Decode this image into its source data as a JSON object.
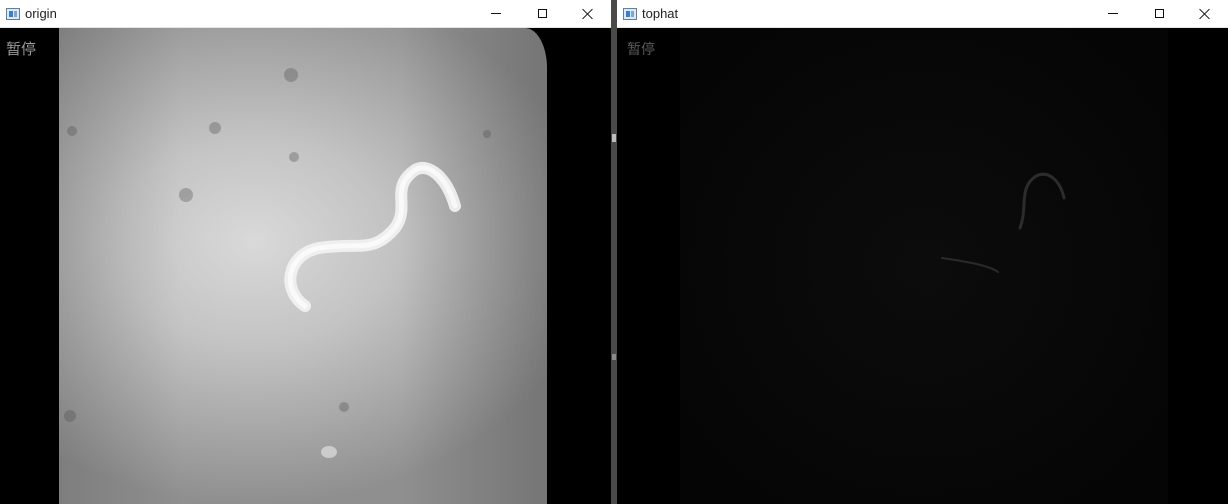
{
  "windows": [
    {
      "title": "origin",
      "overlay_text": "暂停",
      "buttons": {
        "minimize": "minimize",
        "maximize": "maximize",
        "close": "close"
      }
    },
    {
      "title": "tophat",
      "overlay_text": "暂停",
      "buttons": {
        "minimize": "minimize",
        "maximize": "maximize",
        "close": "close"
      }
    }
  ],
  "icons": {
    "app": "opencv-window-icon",
    "minimize": "minimize-icon",
    "maximize": "maximize-icon",
    "close": "close-icon"
  },
  "colors": {
    "titlebar_bg": "#ffffff",
    "canvas_bg": "#000000",
    "worm": "#f2f2f2",
    "frame_gray": "#c3c3c3"
  }
}
